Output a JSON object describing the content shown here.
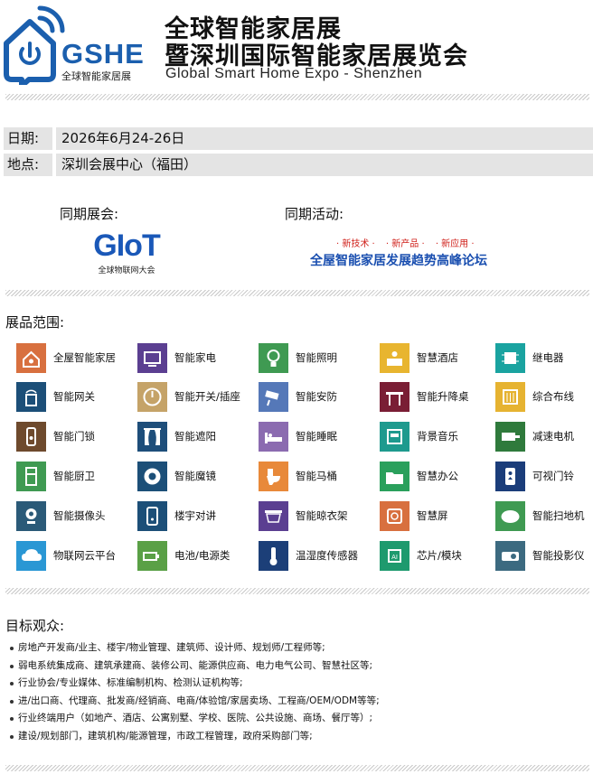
{
  "header": {
    "logo_text": "GSHE",
    "logo_subtitle": "全球智能家居展",
    "title_line1": "全球智能家居展",
    "title_line2": "暨深圳国际智能家居展览会",
    "title_en": "Global Smart Home Expo - Shenzhen"
  },
  "info": {
    "date_label": "日期:",
    "date_value": "2026年6月24-26日",
    "venue_label": "地点:",
    "venue_value": "深圳会展中心（福田）"
  },
  "concurrent": {
    "exhibition_label": "同期展会:",
    "giot_mark": "GIoT",
    "giot_sub": "全球物联网大会",
    "events_label": "同期活动:",
    "tags": [
      "· 新技术 ·",
      "· 新产品 ·",
      "· 新应用 ·"
    ],
    "forum": "全屋智能家居发展趋势高峰论坛"
  },
  "exhibits": {
    "label": "展品范围:",
    "items": [
      {
        "name": "全屋智能家居",
        "icon": "smart-house-icon",
        "color": "#d8703f"
      },
      {
        "name": "智能家电",
        "icon": "tv-icon",
        "color": "#5b3f91"
      },
      {
        "name": "智能照明",
        "icon": "light-bulb-icon",
        "color": "#3f9a52"
      },
      {
        "name": "智慧酒店",
        "icon": "hotel-reception-icon",
        "color": "#e8b52f"
      },
      {
        "name": "继电器",
        "icon": "relay-chip-icon",
        "color": "#1aa3a0"
      },
      {
        "name": "智能网关",
        "icon": "gateway-icon",
        "color": "#1c4f78"
      },
      {
        "name": "智能开关/插座",
        "icon": "power-switch-icon",
        "color": "#c5a368"
      },
      {
        "name": "智能安防",
        "icon": "security-camera-icon",
        "color": "#5578b8"
      },
      {
        "name": "智能升降桌",
        "icon": "lift-desk-icon",
        "color": "#7a1e35"
      },
      {
        "name": "综合布线",
        "icon": "cabling-icon",
        "color": "#e6b331"
      },
      {
        "name": "智能门锁",
        "icon": "door-lock-icon",
        "color": "#6e4a2d"
      },
      {
        "name": "智能遮阳",
        "icon": "curtain-icon",
        "color": "#1e4e7a"
      },
      {
        "name": "智能睡眠",
        "icon": "smart-bed-icon",
        "color": "#8b6bb0"
      },
      {
        "name": "背景音乐",
        "icon": "music-player-icon",
        "color": "#1e9a8e"
      },
      {
        "name": "减速电机",
        "icon": "motor-icon",
        "color": "#2f7a3c"
      },
      {
        "name": "智能厨卫",
        "icon": "fridge-icon",
        "color": "#3f9a52"
      },
      {
        "name": "智能魔镜",
        "icon": "magic-mirror-icon",
        "color": "#1c4f78"
      },
      {
        "name": "智能马桶",
        "icon": "toilet-icon",
        "color": "#e8893a"
      },
      {
        "name": "智慧办公",
        "icon": "office-folder-icon",
        "color": "#2aa05c"
      },
      {
        "name": "可视门铃",
        "icon": "video-doorbell-icon",
        "color": "#1b3d7a"
      },
      {
        "name": "智能摄像头",
        "icon": "webcam-icon",
        "color": "#2b5a78"
      },
      {
        "name": "楼宇对讲",
        "icon": "intercom-icon",
        "color": "#1c4f78"
      },
      {
        "name": "智能晾衣架",
        "icon": "clothes-rack-icon",
        "color": "#5b3f91"
      },
      {
        "name": "智慧屏",
        "icon": "smart-screen-icon",
        "color": "#d8703f"
      },
      {
        "name": "智能扫地机",
        "icon": "robot-vacuum-icon",
        "color": "#3f9a52"
      },
      {
        "name": "物联网云平台",
        "icon": "cloud-icon",
        "color": "#2a97d4"
      },
      {
        "name": "电池/电源类",
        "icon": "battery-plug-icon",
        "color": "#5aa046"
      },
      {
        "name": "温湿度传感器",
        "icon": "thermometer-icon",
        "color": "#1c3f78"
      },
      {
        "name": "芯片/模块",
        "icon": "ai-chip-icon",
        "color": "#1e9a6e"
      },
      {
        "name": "智能投影仪",
        "icon": "projector-icon",
        "color": "#3c6a80"
      }
    ]
  },
  "audience": {
    "label": "目标观众:",
    "items": [
      "房地产开发商/业主、楼宇/物业管理、建筑师、设计师、规划师/工程师等;",
      "弱电系统集成商、建筑承建商、装修公司、能源供应商、电力电气公司、智慧社区等;",
      "行业协会/专业媒体、标准编制机构、检测认证机构等;",
      "进/出口商、代理商、批发商/经销商、电商/体验馆/家居卖场、工程商/OEM/ODM等等;",
      "行业终端用户（如地产、酒店、公寓别墅、学校、医院、公共设施、商场、餐厅等）;",
      "建设/规划部门，建筑机构/能源管理，市政工程管理，政府采购部门等;"
    ]
  },
  "colors": {
    "brand_blue": "#1b5fae",
    "accent_red": "#d0211b",
    "info_bg": "#e4e4e4"
  }
}
